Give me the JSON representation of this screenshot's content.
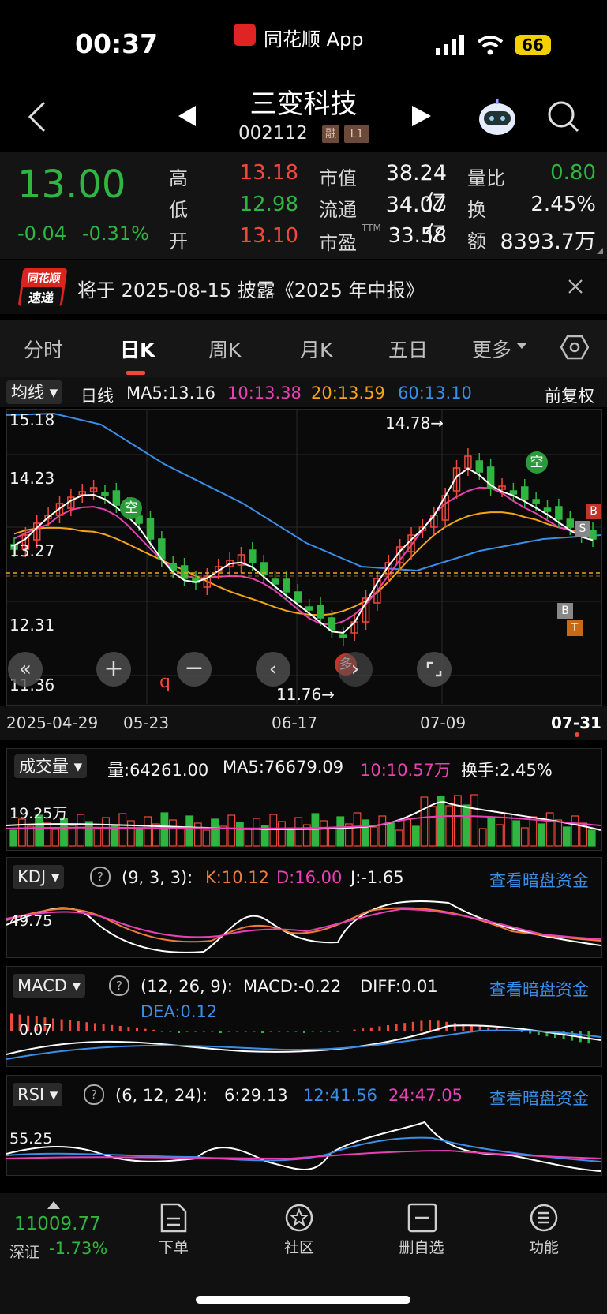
{
  "status_bar": {
    "time": "00:37",
    "app_label": "同花顺 App",
    "battery": "66"
  },
  "header": {
    "stock_name": "三变科技",
    "stock_code": "002112",
    "tag_margin": "融",
    "tag_level": "L1"
  },
  "quote": {
    "price": "13.00",
    "change": "-0.04",
    "change_pct": "-0.31%",
    "high_label": "高",
    "high": "13.18",
    "low_label": "低",
    "low": "12.98",
    "open_label": "开",
    "open": "13.10",
    "mcap_label": "市值",
    "mcap": "38.24亿",
    "float_label": "流通",
    "float": "34.07亿",
    "pe_label": "市盈",
    "pe_sup": "TTM",
    "pe": "33.58",
    "vol_ratio_label": "量比",
    "vol_ratio": "0.80",
    "turnover_label": "换",
    "turnover": "2.45%",
    "amount_label": "额",
    "amount": "8393.7万"
  },
  "notice": {
    "logo_top": "同花顺",
    "logo_bottom": "速递",
    "text": "将于 2025-08-15 披露《2025 年中报》"
  },
  "tabs": [
    "分时",
    "日K",
    "周K",
    "月K",
    "五日",
    "更多"
  ],
  "kline": {
    "selector": "均线",
    "period": "日线",
    "ma5": "MA5:13.16",
    "ma10": "10:13.38",
    "ma20": "20:13.59",
    "ma60": "60:13.10",
    "adjust": "前复权",
    "y_labels": [
      "15.18",
      "14.23",
      "13.27",
      "12.31",
      "11.36"
    ],
    "x_labels": [
      "2025-04-29",
      "05-23",
      "06-17",
      "07-09",
      "07-31"
    ],
    "max_label": "14.78→",
    "min_label": "11.76→",
    "signal_short": "空",
    "signal_long": "多"
  },
  "volume": {
    "selector": "成交量",
    "vol": "量:64261.00",
    "ma5": "MA5:76679.09",
    "ma10": "10:10.57万",
    "turnover": "换手:2.45%",
    "axis": "19.25万"
  },
  "kdj": {
    "selector": "KDJ",
    "params": "(9, 3, 3):",
    "k": "K:10.12",
    "d": "D:16.00",
    "j": "J:-1.65",
    "axis": "49.75",
    "link": "查看暗盘资金"
  },
  "macd": {
    "selector": "MACD",
    "params": "(12, 26, 9):",
    "macd": "MACD:-0.22",
    "diff": "DIFF:0.01",
    "dea": "DEA:0.12",
    "axis": "0.07",
    "link": "查看暗盘资金"
  },
  "rsi": {
    "selector": "RSI",
    "params": "(6, 12, 24):",
    "r6": "6:29.13",
    "r12": "12:41.56",
    "r24": "24:47.05",
    "axis": "55.25",
    "link": "查看暗盘资金"
  },
  "bottom": {
    "index_value": "11009.77",
    "index_name": "深证",
    "index_change": "-1.73%",
    "items": [
      "下单",
      "社区",
      "删自选",
      "功能"
    ]
  },
  "colors": {
    "up": "#f0493c",
    "down": "#2fb540",
    "ma5": "#ffffff",
    "ma10": "#e940b5",
    "ma20": "#f6a418",
    "ma60": "#3a8ee8"
  }
}
